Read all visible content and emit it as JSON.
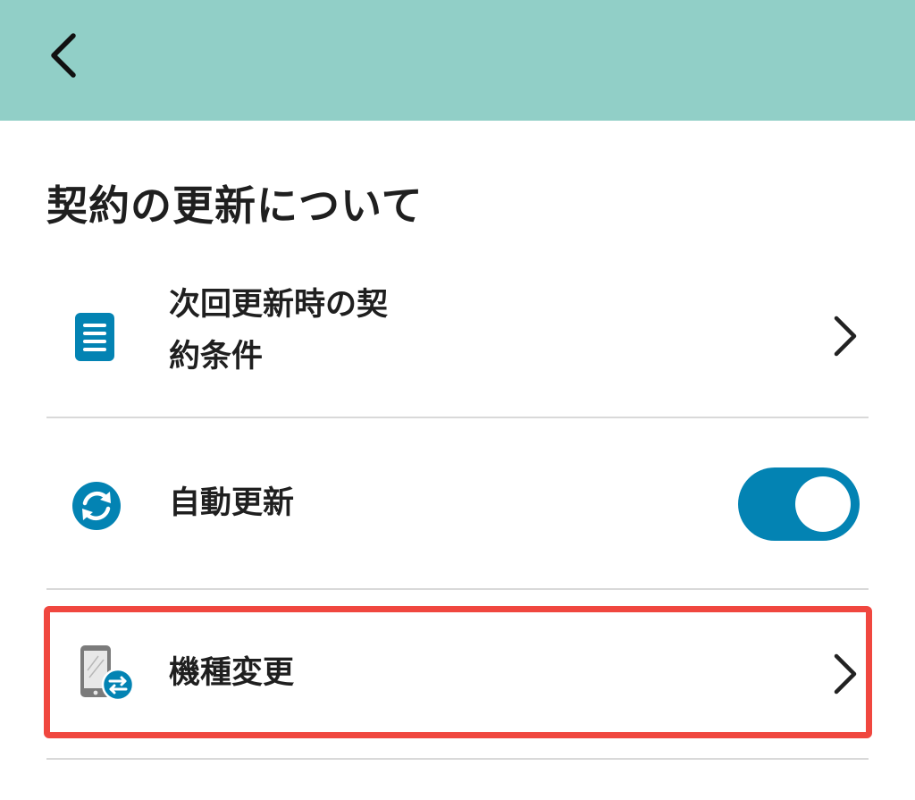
{
  "header": {
    "back_icon": "chevron-left-icon",
    "color": "#91cfc7"
  },
  "section": {
    "title": "契約の更新について"
  },
  "rows": [
    {
      "label_line1": "次回更新時の契",
      "label_line2": "約条件",
      "icon": "document-icon",
      "trailing": "chevron-right-icon"
    },
    {
      "label": "自動更新",
      "icon": "refresh-icon",
      "trailing": "toggle",
      "toggle_on": true
    },
    {
      "label": "機種変更",
      "icon": "phone-exchange-icon",
      "trailing": "chevron-right-icon",
      "highlighted": true
    }
  ],
  "colors": {
    "accent": "#0383b3",
    "highlight": "#f0473f",
    "divider": "#d9d9d9"
  }
}
